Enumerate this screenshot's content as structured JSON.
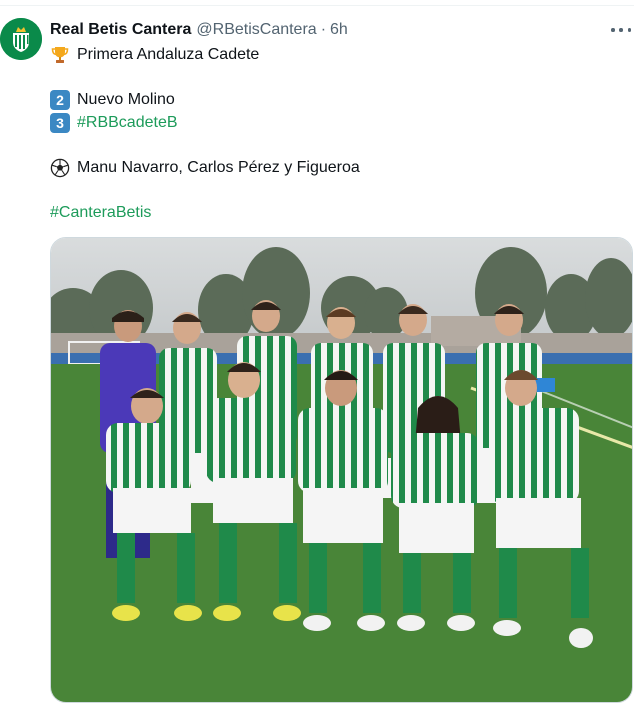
{
  "tweet": {
    "author": {
      "display_name": "Real Betis Cantera",
      "handle": "@RBetisCantera",
      "separator": "·",
      "time": "6h",
      "avatar_icon": "real-betis-crest-icon"
    },
    "lines": {
      "competition": {
        "icon": "trophy-icon",
        "text": "Primera Andaluza Cadete"
      },
      "team_a": {
        "badge": "2",
        "text": "Nuevo Molino"
      },
      "team_b": {
        "badge": "3",
        "text": "#RBBcadeteB"
      },
      "scorers": {
        "icon": "soccer-ball-icon",
        "text": "Manu Navarro, Carlos Pérez y Figueroa"
      },
      "hashtag": {
        "text": "#CanteraBetis"
      }
    },
    "media": {
      "description_icon": "team-photo"
    },
    "colors": {
      "link": "#1d9b5a",
      "keycap": "#3b88c3",
      "betis_green": "#0a8a4a",
      "muted": "#536471"
    }
  }
}
